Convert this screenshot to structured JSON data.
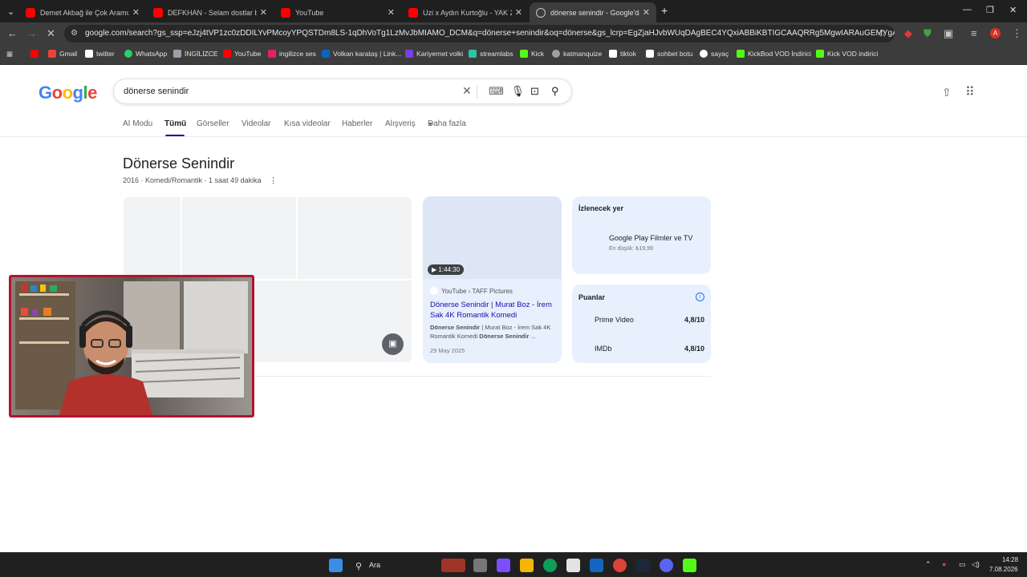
{
  "browser": {
    "tabs": [
      {
        "title": "Demet Akbağ ile Çok Aramızda",
        "color": "#ff0000"
      },
      {
        "title": "DEFKHAN - Selam dostlar ben",
        "color": "#ff0000"
      },
      {
        "title": "YouTube",
        "color": "#ff0000"
      },
      {
        "title": "Uzi x Aydın Kurtoğlu - YAK 2.0",
        "color": "#ff0000"
      },
      {
        "title": "dönerse senindir - Google'da A",
        "color": "#9aa0a6"
      }
    ],
    "url": "google.com/search?gs_ssp=eJzj4tVP1zc0zDDILYvPMcoyYPQSTDm8LS-1qDhVoTg1LzMvJbMIAMO_DCM&q=dönerse+senindir&oq=dönerse&gs_lcrp=EgZjaHJvbWUqDAgBEC4YQxiABBiKBTIGCAAQRRg5MgwIARAuGEMYgAQYigUyBwgCEC...",
    "bookmarks": [
      {
        "label": "",
        "color": "#ff0000"
      },
      {
        "label": "Gmail",
        "color": "#ea4335"
      },
      {
        "label": "twitter",
        "color": "#ffffff"
      },
      {
        "label": "WhatsApp",
        "color": "#25d366"
      },
      {
        "label": "İNGİLİZCE",
        "color": "#9aa0a6"
      },
      {
        "label": "YouTube",
        "color": "#ff0000"
      },
      {
        "label": "ingilizce ses",
        "color": "#e91e63"
      },
      {
        "label": "Volkan karataş | Link...",
        "color": "#0a66c2"
      },
      {
        "label": "Kariyernet volki",
        "color": "#7b3fe4"
      },
      {
        "label": "streamlabs",
        "color": "#31c3a2"
      },
      {
        "label": "Kick",
        "color": "#53fc18"
      },
      {
        "label": "katmanquize",
        "color": "#9aa0a6"
      },
      {
        "label": "tiktok",
        "color": "#ffffff"
      },
      {
        "label": "sohbet botu",
        "color": "#ffffff"
      },
      {
        "label": "sayaç",
        "color": "#ffffff"
      },
      {
        "label": "KickBod VOD İndirici",
        "color": "#53fc18"
      },
      {
        "label": "Kick VOD indirici",
        "color": "#53fc18"
      }
    ]
  },
  "google": {
    "logo": "Google",
    "query": "dönerse senindir",
    "tabs": [
      "AI Modu",
      "Tümü",
      "Görseller",
      "Videolar",
      "Kısa videolar",
      "Haberler",
      "Alışveriş",
      "Daha fazla"
    ],
    "active_tab": "Tümü"
  },
  "result": {
    "title": "Dönerse Senindir",
    "meta": "2016 · Komedi/Romantik · 1 saat 49 dakika",
    "video": {
      "duration": "1:44:30",
      "source": "YouTube › TAFF Pictures",
      "title": "Dönerse Senindir | Murat Boz - İrem Sak 4K Romantik Komedi",
      "snippet_bold": "Dönerse Senindir",
      "snippet_rest": " | Murat Boz - İrem Sak 4K Romantik Komedi ",
      "snippet_bold2": "Dönerse Senindir",
      "snippet_end": " ...",
      "date": "29 May 2025"
    },
    "watch": {
      "heading": "İzlenecek yer",
      "provider": "Google Play Filmler ve TV",
      "price": "En düşük: ₺19,99"
    },
    "ratings": {
      "heading": "Puanlar",
      "items": [
        {
          "source": "Prime Video",
          "value": "4,8/10"
        },
        {
          "source": "IMDb",
          "value": "4,8/10"
        }
      ]
    }
  },
  "taskbar": {
    "search_label": "Ara",
    "time": "14:28",
    "date": "7.08.2026"
  },
  "colors": {
    "link": "#1a0dab",
    "accent": "#1a73e8",
    "card": "#e8f0fe"
  }
}
